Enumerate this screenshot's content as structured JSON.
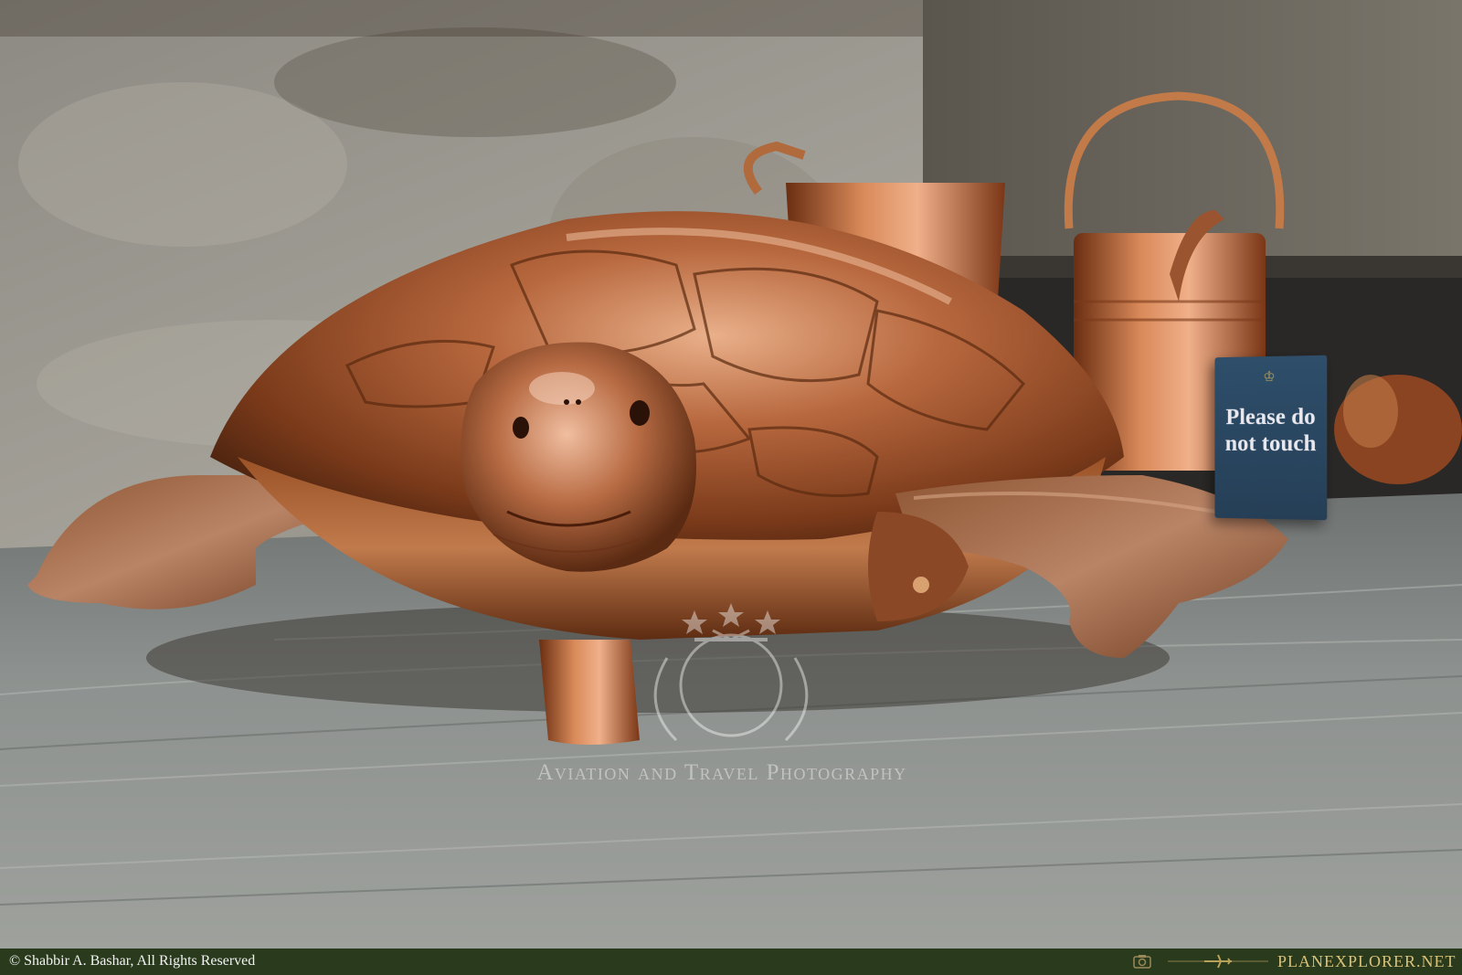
{
  "photo": {
    "subject": "Copper tortoise-shaped vessel on a wooden table, with copper jugs and kettles behind it",
    "sign": {
      "text": "Please do not touch",
      "background_color": "#2b4763",
      "text_color": "#e8e8ee",
      "icon": "crest-icon"
    }
  },
  "watermark": {
    "tagline": "Aviation and Travel Photography",
    "emblem_icon": "laurel-stars-globe-icon"
  },
  "footer": {
    "copyright": "© Shabbir A. Bashar, All Rights Reserved",
    "brand": "PLANEXPLORER.NET",
    "brand_color": "#d9c27a",
    "bar_color": "#2a3a1c",
    "camera_icon": "camera-icon",
    "plane_icon": "airplane-icon"
  }
}
